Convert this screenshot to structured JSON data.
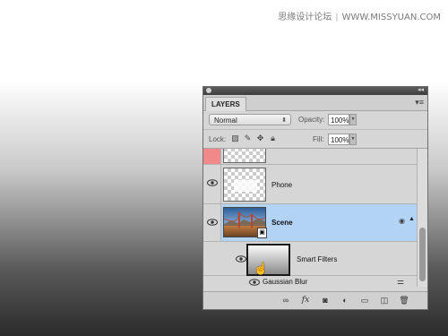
{
  "watermark": {
    "site_cn": "思缘设计论坛",
    "url": "WWW.MISSYUAN.COM"
  },
  "panel": {
    "tab_label": "LAYERS",
    "menu_icon": "panel-menu-icon",
    "blend_mode": "Normal",
    "opacity_label": "Opacity:",
    "opacity_value": "100%",
    "lock_label": "Lock:",
    "fill_label": "Fill:",
    "fill_value": "100%"
  },
  "layers": [
    {
      "name": "",
      "visible": false,
      "selected": false,
      "type": "transparent"
    },
    {
      "name": "Phone",
      "visible": true,
      "selected": false,
      "type": "phone"
    },
    {
      "name": "Scene",
      "visible": true,
      "selected": true,
      "type": "scene"
    },
    {
      "name": "Smart Filters",
      "visible": true,
      "selected": false,
      "type": "smart-filter"
    },
    {
      "name": "Gaussian Blur",
      "visible": true,
      "selected": false,
      "type": "filter"
    }
  ],
  "colors": {
    "selected_row": "#b3d3f5",
    "color_label_red": "#f08a8a"
  },
  "bottom_icons": [
    "link-icon",
    "fx-icon",
    "mask-icon",
    "adjustment-icon",
    "folder-icon",
    "new-layer-icon",
    "trash-icon"
  ]
}
